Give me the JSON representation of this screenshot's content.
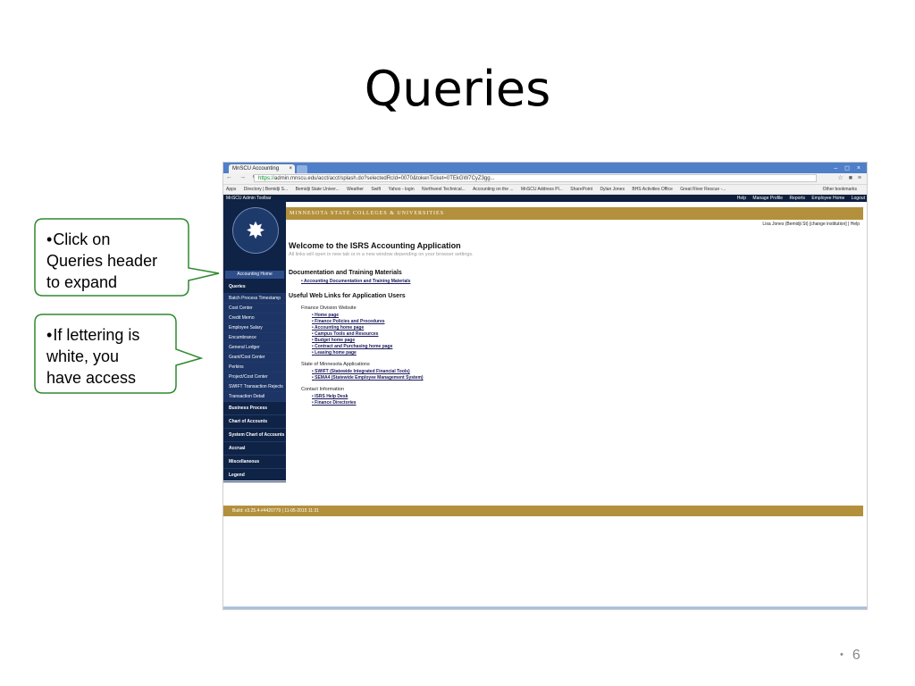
{
  "slide": {
    "title": "Queries",
    "number": "6",
    "bullet_dot": "•"
  },
  "callouts": [
    {
      "bullet": "•",
      "lines": [
        "Click on",
        "Queries header",
        "to expand"
      ]
    },
    {
      "bullet": "•",
      "lines": [
        "If lettering is",
        "white, you",
        "have access"
      ]
    }
  ],
  "browser": {
    "tab_title": "MnSCU Accounting",
    "tab_close": "×",
    "window_controls": "– ◻ ×",
    "nav_glyphs": "← → C",
    "url_scheme": "https://",
    "url_rest": "admin.mnscu.edu/acct/acct/splash.do?selectedRcId=0070&tokenTicket=0TEkGW7CyZ3gg...",
    "bookmarks": [
      "Apps",
      "Directory | Bemidji S...",
      "Bemidji State Univer...",
      "Weather",
      "Swift",
      "Yahoo - login",
      "Northwest Technical...",
      "Accounting on the ...",
      "MnSCU Address Pl...",
      "SharePoint",
      "Dylan Jones",
      "BHS Activities Office",
      "Great River Rescue -..."
    ],
    "other_bookmarks": "Other bookmarks",
    "admin_toolbar": "MnSCU Admin Toolbar",
    "admin_links": [
      "Help",
      "Manage Profile",
      "Reports",
      "Employee Home",
      "Logout"
    ]
  },
  "app": {
    "brand_band": "MINNESOTA STATE COLLEGES & UNIVERSITIES",
    "user_line": "Lisa Jones (Bemidji St) [change institution] | Help",
    "nav_home": "Accounting Home",
    "nav_items": [
      {
        "label": "Queries",
        "type": "head"
      },
      {
        "label": "Batch Process Timestamp",
        "type": "sub"
      },
      {
        "label": "Cost Center",
        "type": "sub"
      },
      {
        "label": "Credit Memo",
        "type": "sub"
      },
      {
        "label": "Employee Salary",
        "type": "sub"
      },
      {
        "label": "Encumbrance",
        "type": "sub"
      },
      {
        "label": "General Ledger",
        "type": "sub"
      },
      {
        "label": "Grant/Cost Center",
        "type": "sub"
      },
      {
        "label": "Perkins",
        "type": "sub"
      },
      {
        "label": "Project/Cost Center",
        "type": "sub"
      },
      {
        "label": "SWIFT Transaction Rejects",
        "type": "sub"
      },
      {
        "label": "Transaction Detail",
        "type": "sub"
      },
      {
        "label": "Business Process",
        "type": "head"
      },
      {
        "label": "Chart of Accounts",
        "type": "head"
      },
      {
        "label": "System Chart of Accounts",
        "type": "head"
      },
      {
        "label": "Accrual",
        "type": "head"
      },
      {
        "label": "Miscellaneous",
        "type": "head"
      },
      {
        "label": "Legend",
        "type": "head"
      }
    ],
    "welcome_title": "Welcome to the ISRS Accounting Application",
    "welcome_note": "All links will open in new tab or in a new window depending on your browser settings.",
    "doc_heading": "Documentation and Training Materials",
    "doc_links": [
      "Accounting Documentation and Training Materials"
    ],
    "useful_heading": "Useful Web Links for Application Users",
    "groups": [
      {
        "title": "Finance Division Website",
        "links": [
          "Home page",
          "Finance Policies and Procedures",
          "Accounting home page",
          "Campus Tools and Resources",
          "Budget home page",
          "Contract and Purchasing home page",
          "Leasing home page"
        ]
      },
      {
        "title": "State of Minnesota Applications",
        "links": [
          "SWIFT (Statewide Integrated Financial Tools)",
          "SEMA4 (Statewide Employee Management System)"
        ]
      },
      {
        "title": "Contact Information",
        "links": [
          "ISRS Help Desk",
          "Finance Directories"
        ]
      }
    ],
    "build": "Build: v3.25.4-#4420779 | 11-05-2015 11:31"
  },
  "colors": {
    "nav_bg": "#0f2347",
    "gold": "#b3903c",
    "callout_border": "#2f8a2f",
    "browser_frame": "#4f7fc9"
  }
}
